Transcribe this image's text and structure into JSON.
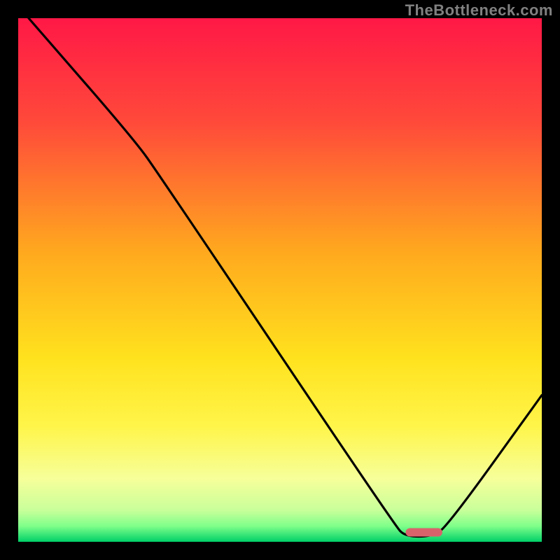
{
  "watermark": "TheBottleneck.com",
  "chart_data": {
    "type": "line",
    "title": "",
    "xlabel": "",
    "ylabel": "",
    "xlim": [
      0,
      100
    ],
    "ylim": [
      0,
      100
    ],
    "gradient_stops": [
      {
        "offset": 0,
        "color": "#ff1846"
      },
      {
        "offset": 20,
        "color": "#ff4a3a"
      },
      {
        "offset": 45,
        "color": "#ffaa1e"
      },
      {
        "offset": 65,
        "color": "#ffe21e"
      },
      {
        "offset": 78,
        "color": "#fff54a"
      },
      {
        "offset": 88,
        "color": "#f6ff9a"
      },
      {
        "offset": 94,
        "color": "#c8ff9a"
      },
      {
        "offset": 97,
        "color": "#7fff8a"
      },
      {
        "offset": 100,
        "color": "#00d068"
      }
    ],
    "series": [
      {
        "name": "bottleneck-curve",
        "points": [
          {
            "x": 2,
            "y": 100
          },
          {
            "x": 22,
            "y": 77
          },
          {
            "x": 27,
            "y": 70
          },
          {
            "x": 72,
            "y": 3
          },
          {
            "x": 74,
            "y": 1
          },
          {
            "x": 79,
            "y": 1
          },
          {
            "x": 82,
            "y": 3
          },
          {
            "x": 100,
            "y": 28
          }
        ]
      }
    ],
    "marker": {
      "x_start": 74,
      "x_end": 81,
      "y": 1.8,
      "color": "#d9636b"
    }
  }
}
